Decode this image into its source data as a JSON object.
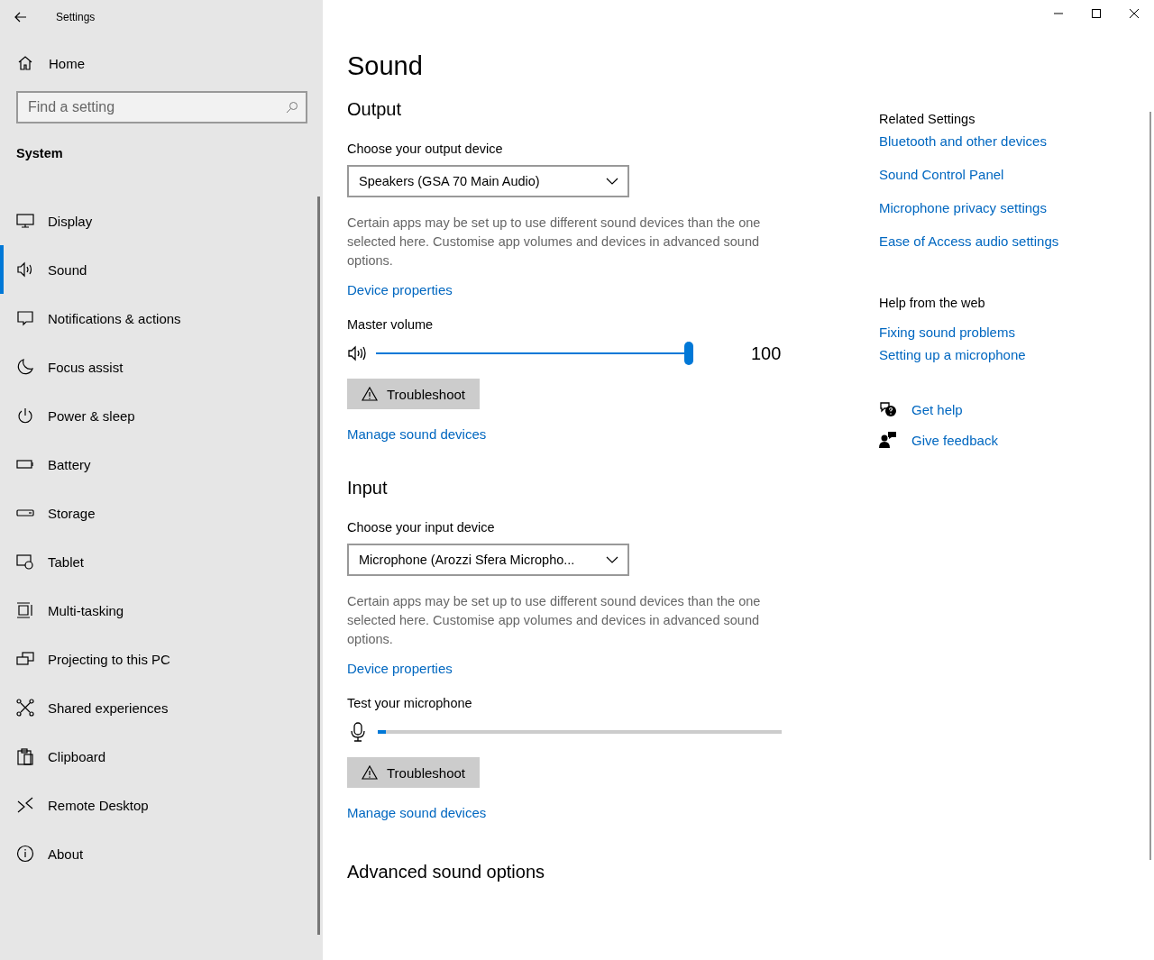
{
  "window": {
    "title": "Settings"
  },
  "sidebar": {
    "home": "Home",
    "search": {
      "placeholder": "Find a setting"
    },
    "section": "System",
    "items": [
      {
        "label": "Display",
        "selected": false
      },
      {
        "label": "Sound",
        "selected": true
      },
      {
        "label": "Notifications & actions",
        "selected": false
      },
      {
        "label": "Focus assist",
        "selected": false
      },
      {
        "label": "Power & sleep",
        "selected": false
      },
      {
        "label": "Battery",
        "selected": false
      },
      {
        "label": "Storage",
        "selected": false
      },
      {
        "label": "Tablet",
        "selected": false
      },
      {
        "label": "Multi-tasking",
        "selected": false
      },
      {
        "label": "Projecting to this PC",
        "selected": false
      },
      {
        "label": "Shared experiences",
        "selected": false
      },
      {
        "label": "Clipboard",
        "selected": false
      },
      {
        "label": "Remote Desktop",
        "selected": false
      },
      {
        "label": "About",
        "selected": false
      }
    ]
  },
  "page": {
    "title": "Sound",
    "output": {
      "heading": "Output",
      "device_label": "Choose your output device",
      "device": "Speakers (GSA 70 Main Audio)",
      "note": "Certain apps may be set up to use different sound devices than the one selected here. Customise app volumes and devices in advanced sound options.",
      "properties_link": "Device properties",
      "volume_label": "Master volume",
      "level": 1.0,
      "reading": "100",
      "troubleshoot": "Troubleshoot",
      "manage_link": "Manage sound devices"
    },
    "input": {
      "heading": "Input",
      "device_label": "Choose your input device",
      "device": "Microphone (Arozzi Sfera Micropho...",
      "note": "Certain apps may be set up to use different sound devices than the one selected here. Customise app volumes and devices in advanced sound options.",
      "properties_link": "Device properties",
      "test_label": "Test your microphone",
      "level": 0.02,
      "troubleshoot": "Troubleshoot",
      "manage_link": "Manage sound devices"
    },
    "advanced_heading": "Advanced sound options"
  },
  "related": {
    "heading": "Related Settings",
    "links": [
      "Bluetooth and other devices",
      "Sound Control Panel",
      "Microphone privacy settings",
      "Ease of Access audio settings"
    ]
  },
  "help": {
    "heading": "Help from the web",
    "links": [
      "Fixing sound problems",
      "Setting up a microphone"
    ]
  },
  "support": [
    {
      "kind": "help",
      "label": "Get help"
    },
    {
      "kind": "feedback",
      "label": "Give feedback"
    }
  ]
}
